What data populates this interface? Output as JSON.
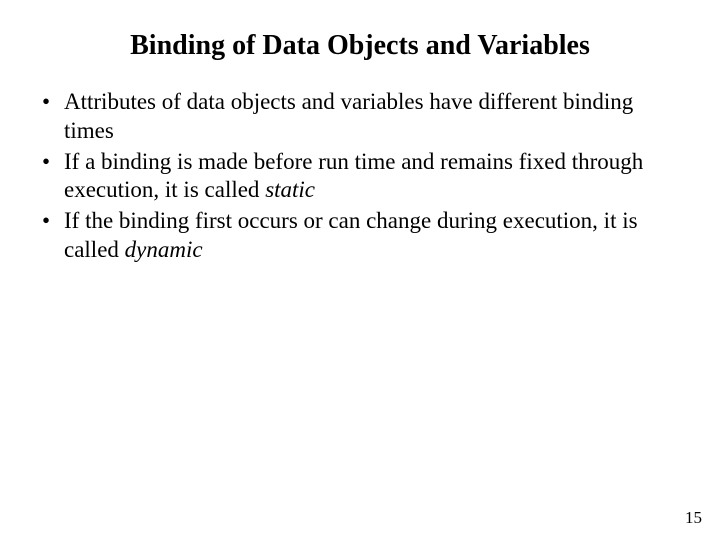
{
  "title": "Binding of Data Objects and Variables",
  "bullets": [
    {
      "pre": "Attributes of data objects and variables have different binding times",
      "em": "",
      "post": ""
    },
    {
      "pre": "If a binding is made before run time and remains fixed through execution, it is called ",
      "em": "static",
      "post": ""
    },
    {
      "pre": "If the binding first occurs or can change during execution, it is called ",
      "em": "dynamic",
      "post": ""
    }
  ],
  "page_number": "15"
}
